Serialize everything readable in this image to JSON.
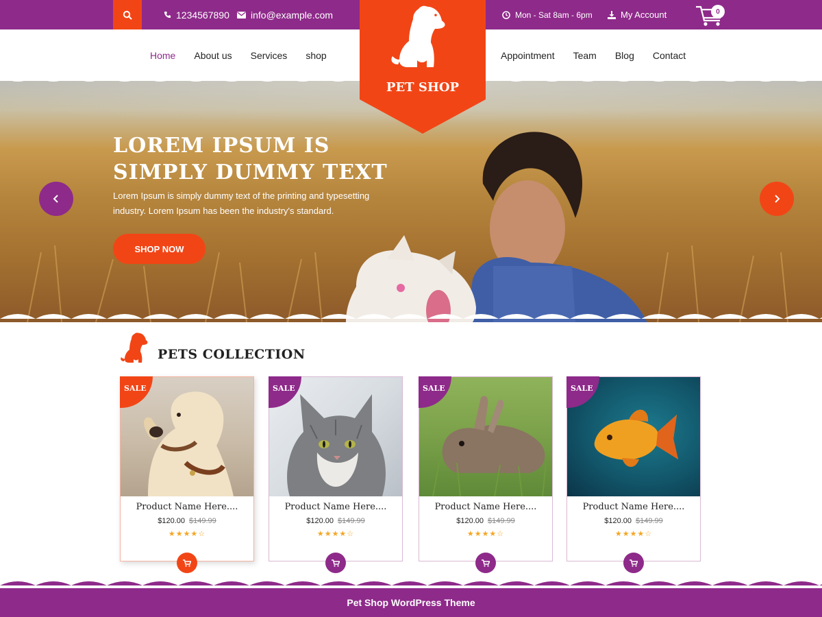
{
  "topbar": {
    "phone": "1234567890",
    "email": "info@example.com",
    "hours": "Mon - Sat 8am - 6pm",
    "account": "My Account",
    "cart_count": "0"
  },
  "logo": {
    "text": "PET SHOP"
  },
  "nav": {
    "left": [
      "Home",
      "About us",
      "Services",
      "shop"
    ],
    "right": [
      "Appointment",
      "Team",
      "Blog",
      "Contact"
    ],
    "active": "Home"
  },
  "hero": {
    "title_line1": "LOREM IPSUM IS",
    "title_line2": "SIMPLY DUMMY TEXT",
    "text_line1": "Lorem Ipsum is simply dummy text of the printing and typesetting",
    "text_line2": "industry. Lorem Ipsum has been the industry's standard.",
    "button": "SHOP NOW"
  },
  "section": {
    "title": "PETS COLLECTION"
  },
  "products": [
    {
      "badge": "SALE",
      "name": "Product Name Here....",
      "price": "$120.00",
      "old_price": "$149.99",
      "stars": "★★★★☆",
      "rating": 4,
      "image": "dog"
    },
    {
      "badge": "SALE",
      "name": "Product Name Here....",
      "price": "$120.00",
      "old_price": "$149.99",
      "stars": "★★★★☆",
      "rating": 4,
      "image": "cat"
    },
    {
      "badge": "SALE",
      "name": "Product Name Here....",
      "price": "$120.00",
      "old_price": "$149.99",
      "stars": "★★★★☆",
      "rating": 4,
      "image": "rabbit"
    },
    {
      "badge": "SALE",
      "name": "Product Name Here....",
      "price": "$120.00",
      "old_price": "$149.99",
      "stars": "★★★★☆",
      "rating": 4,
      "image": "fish"
    }
  ],
  "footer": {
    "text": "Pet Shop WordPress Theme"
  },
  "colors": {
    "primary": "#8e2a8a",
    "accent": "#f24516",
    "star": "#f5a623"
  }
}
